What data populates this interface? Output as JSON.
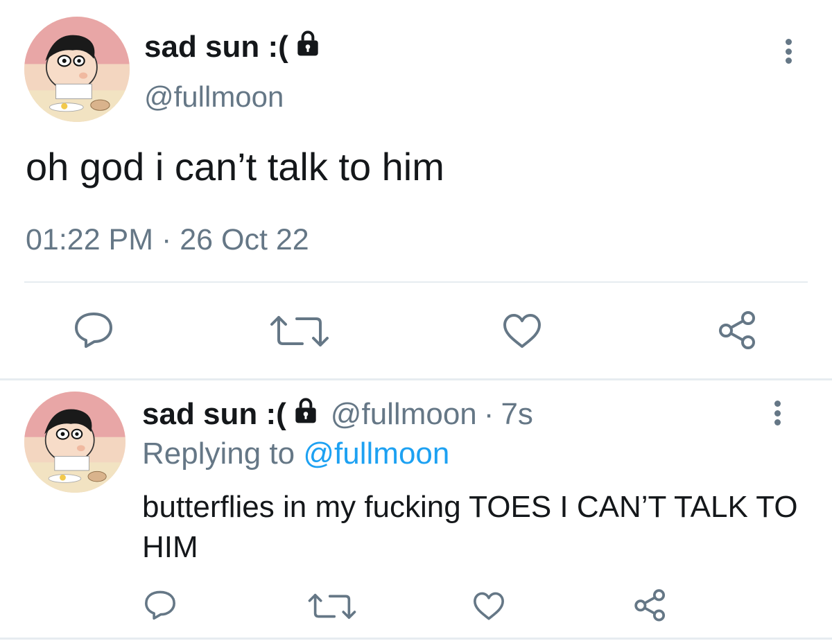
{
  "main_tweet": {
    "display_name": "sad sun :(",
    "handle": "@fullmoon",
    "text": "oh god i can’t talk to him",
    "timestamp": "01:22 PM · 26 Oct 22",
    "actions": [
      "reply-icon",
      "retweet-icon",
      "like-icon",
      "share-icon"
    ]
  },
  "reply_tweet": {
    "display_name": "sad sun :(",
    "handle": "@fullmoon",
    "separator": "·",
    "age": "7s",
    "replying_label": "Replying to",
    "replying_to": "@fullmoon",
    "text": "butterflies in my fucking TOES I CAN’T TALK TO HIM",
    "actions": [
      "reply-icon",
      "retweet-icon",
      "like-icon",
      "share-icon"
    ]
  },
  "colors": {
    "primary_text": "#14171a",
    "secondary_text": "#657786",
    "link": "#1da1f2",
    "divider": "#e6ecf0",
    "icon": "#657786"
  }
}
